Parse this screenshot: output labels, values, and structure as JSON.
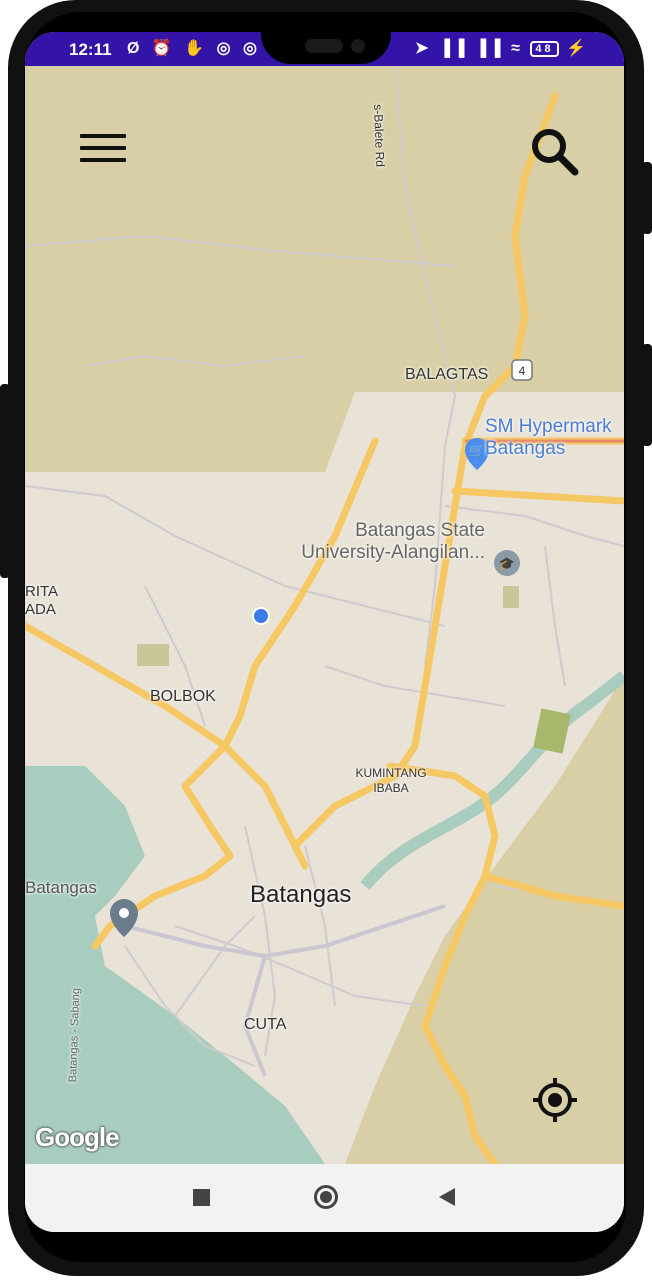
{
  "status_bar": {
    "time": "12:11",
    "left_icons": "Ø ⏰ ✋ ◎ ◎",
    "right_icons": "➤ ▐▐ ▐▐ ≈",
    "battery": "48",
    "charging": "⚡"
  },
  "toolbar": {
    "menu_icon": "hamburger-menu-icon",
    "search_icon": "magnifier-search-icon"
  },
  "map": {
    "road_shield": "4",
    "labels": {
      "road_top": "s-Balete Rd",
      "balagtas": "BALAGTAS",
      "sm_line1": "SM Hypermark",
      "sm_line2": "Batangas",
      "bsu_line1": "Batangas State",
      "bsu_line2": "University-Alangilan...",
      "rita_line1": "RITA",
      "rita_line2": "ADA",
      "bolbok": "BOLBOK",
      "kumintang_line1": "KUMINTANG",
      "kumintang_line2": "IBABA",
      "port": "Batangas",
      "city": "Batangas",
      "cuta": "CUTA",
      "sabang_road": "Batangas - Sabang"
    },
    "attribution": "Google",
    "colors": {
      "land": "#e9e2d6",
      "rural": "#d9cfa6",
      "water": "#a8cdbf",
      "highway": "#f5c863",
      "road": "#cfcbd0",
      "current_location": "#3b7de8"
    }
  },
  "my_location_icon": "crosshair-target-icon",
  "nav_bar": {
    "back_icon": "triangle-back-icon",
    "home_icon": "circle-home-icon",
    "recents_icon": "square-recents-icon"
  }
}
